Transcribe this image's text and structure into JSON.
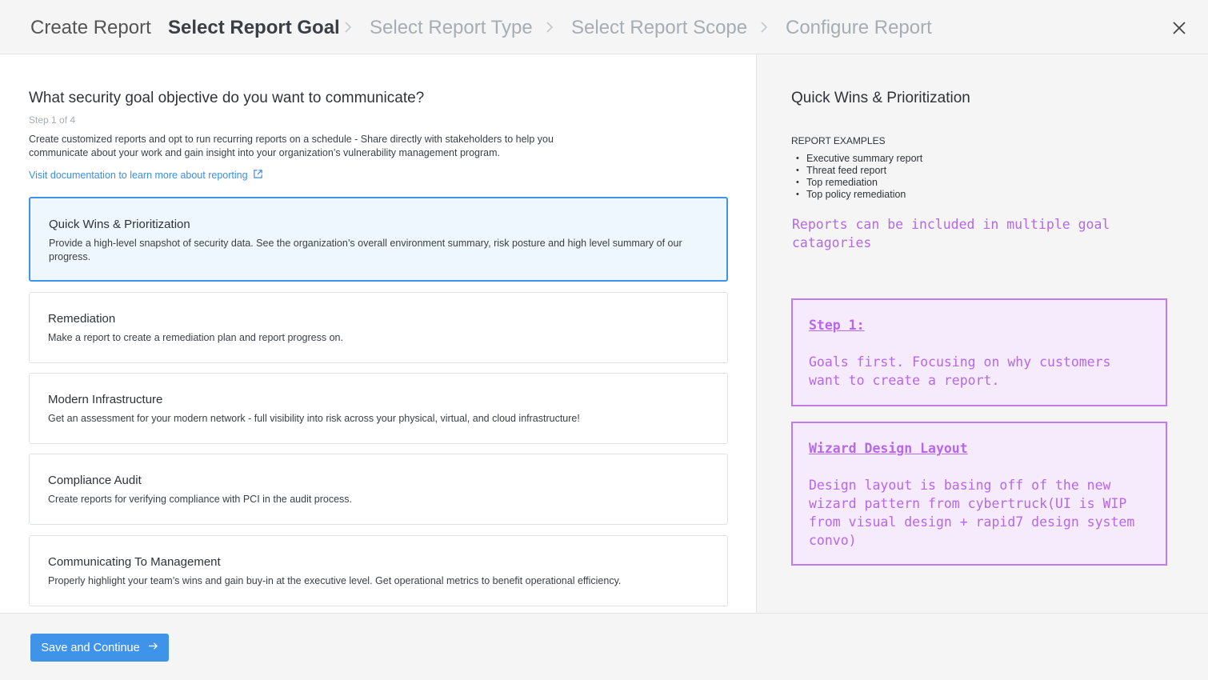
{
  "header": {
    "title": "Create Report",
    "steps": [
      {
        "label": "Select Report Goal",
        "active": true
      },
      {
        "label": "Select Report Type",
        "active": false
      },
      {
        "label": "Select Report Scope",
        "active": false
      },
      {
        "label": "Configure Report",
        "active": false
      }
    ]
  },
  "main": {
    "question": "What security goal objective do you want to communicate?",
    "step": "Step 1 of 4",
    "description": "Create customized reports and opt to run recurring reports on a schedule - Share directly with stakeholders to help you communicate about your work and gain insight into your organization’s vulnerability management program.",
    "doc_link": "Visit documentation to learn more about reporting",
    "goals": [
      {
        "title": "Quick Wins & Prioritization",
        "text": "Provide a high-level snapshot of security data. See the organization’s overall environment summary, risk posture and high level summary of our progress.",
        "selected": true
      },
      {
        "title": "Remediation",
        "text": "Make a report to create a remediation plan and report progress on.",
        "selected": false
      },
      {
        "title": "Modern Infrastructure",
        "text": "Get an assessment for your modern network - full visibility into risk across your physical, virtual, and cloud infrastructure!",
        "selected": false
      },
      {
        "title": "Compliance Audit",
        "text": "Create reports for verifying compliance with PCI in the audit process.",
        "selected": false
      },
      {
        "title": "Communicating To Management",
        "text": "Properly highlight your team’s wins and gain buy-in at the executive level. Get operational metrics to benefit operational efficiency.",
        "selected": false
      }
    ]
  },
  "side": {
    "title": "Quick Wins & Prioritization",
    "examples_heading": "REPORT EXAMPLES",
    "examples": [
      "Executive summary report",
      "Threat feed report",
      "Top remediation",
      "Top policy remediation"
    ],
    "note": "Reports can be included in multiple goal catagories",
    "annotations": [
      {
        "heading": "Step 1:",
        "body": "Goals first. Focusing on why customers want to create a report."
      },
      {
        "heading": "Wizard Design Layout",
        "body": "Design layout is basing off of the new wizard pattern from cybertruck(UI is WIP from visual design + rapid7 design system convo)"
      }
    ]
  },
  "footer": {
    "save_label": "Save and Continue"
  },
  "colors": {
    "accent": "#3f94ea",
    "annotation": "#b668e6",
    "selected_bg": "#eef7fd"
  },
  "icons": {
    "breadcrumb_separator": "chevron-right-icon",
    "close": "close-icon",
    "doc_link": "external-link-icon",
    "save": "arrow-right-icon"
  }
}
